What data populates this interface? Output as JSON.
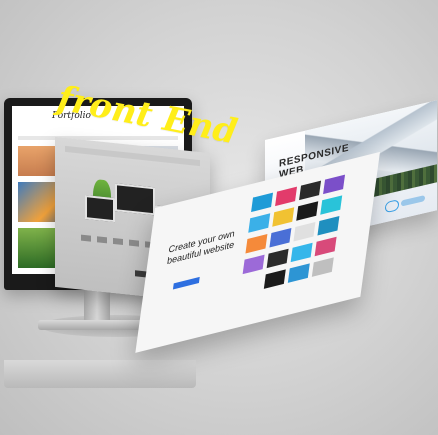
{
  "overlay": {
    "title": "front End"
  },
  "monitor": {
    "logo": "Portfolio"
  },
  "right_panel": {
    "title": "RESPONSIVE\nWEB\nDESIGN."
  },
  "front_panel": {
    "headline": "Create your own beautiful website"
  },
  "colors": {
    "background": "#d2d2d2",
    "title_yellow": "#ffee1a",
    "accent_blue": "#2e6fe0",
    "panel_white": "#f6f6f6"
  }
}
